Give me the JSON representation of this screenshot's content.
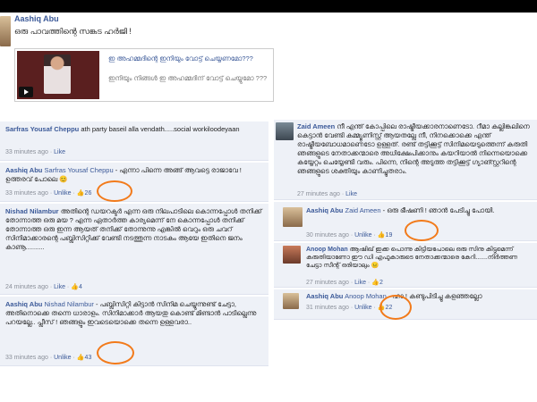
{
  "post": {
    "author": "Aashiq Abu",
    "text": "ഒരു പാവത്തിന്റെ സങ്കട ഹർജി !",
    "card_title": "ഇ അഹമ്മദിന്റെ ഇനിയും വോട്ട് ചെയ്യണമോ???",
    "card_desc": "ഇനിയും നിങ്ങൾ ഇ അഹമ്മദിന് വോട്ട് ചെയ്യുമോ ???"
  },
  "left_comments": [
    {
      "author": "Sarfras Yousaf Cheppu",
      "text": "ath party baseil alla vendath.....social workiloodeyaan",
      "time": "33 minutes ago",
      "sep": "·",
      "action": "Like",
      "likes": ""
    },
    {
      "author": "Aashiq Abu",
      "mention": "Sarfras Yousaf Cheppu",
      "text": "- എന്നാ പിന്നെ അങ്ങ് ആവട്ടെ രാജാവേ ! ഉത്തരവ് പോലെ 😊",
      "time": "33 minutes ago",
      "sep": "·",
      "action": "Unlike",
      "likes": "26"
    },
    {
      "author": "Nishad Nilambur",
      "text": "അതിന്റെ ഡയറക്ടർ എന്ന ഒരു നിലപാടിലെ കൊന്നപ്പോൾ തനിക്ക് തോന്നാത്ത ഒരു മയ ? എന്ന ഏതാർത്ത കാര്യമെന്ന് നേ കൊന്നപ്പോൾ തനിക്ക് തോന്നാത്ത ഒരു ഇന്ന ആയത് തനിക്ക് തോന്നുന്നു എങ്കിൽ വെറും ഒരു ചവറ് സിനിമാക്കാരന്റെ പബ്ലിസിറ്റിക്ക് വേണ്ടി നടത്തുന്ന നാടകം ആയേ ഇതിനെ ജനം കാണൂ..........",
      "time": "24 minutes ago",
      "sep": "·",
      "action": "Like",
      "likes": "4"
    },
    {
      "author": "Aashiq Abu",
      "mention": "Nishad Nilambur",
      "text": "- പബ്ലിസിറ്റി കിട്ടാൻ സിനിമ ചെയ്യുന്നുണ്ട് ചേട്ടാ, അതിനൊക്കെ തന്നെ ധാരാളം. സിനിമാക്കാർ ആയതു കൊണ്ട് മിണ്ടാൻ പാടില്ലെന്നു പറയല്ലേ.. പ്ലീസ് ! ഞങ്ങളും ഇവടെയൊക്കെ തന്നെ ഉള്ളവരാ..",
      "time": "33 minutes ago",
      "sep": "·",
      "action": "Unlike",
      "likes": "43"
    }
  ],
  "right_comments": [
    {
      "author": "Zaid Ameen",
      "text": "നീ എന്ത് കോപ്പിലെ രാഷ്ട്രീയക്കാരനാണെടോ. റീമാ കല്ലിങ്കലിനെ കെട്ടാൻ വേണ്ടി കമ്മ്യൂണിസ്റ്റ് ആയതല്ലേ നീ, നിനക്കൊക്കെ എന്ത് രാഷ്ട്രീയബോധമാണെടോ ഉള്ളത്. രണ്ട് തട്ടിക്കൂട്ട് സിനിമയെടുത്തെന്ന് കരുതി ഞങ്ങളുടെ നേതാക്കന്മാരെ അധിക്ഷേപിക്കാനും കയറിയാൽ നിന്നെയൊക്കെ കയ്യേറ്റം ചെയ്യേണ്ടി വരും. പിന്നെ, നിന്റെ അടുത്ത തട്ടിക്കൂട്ട് ഗ്യാങ്സ്റ്ററിന്റെ ഞങ്ങളുടെ ശക്തിയും കാണിച്ചുതരാം.",
      "time": "27 minutes ago",
      "sep": "·",
      "action": "Like",
      "likes": ""
    },
    {
      "author": "Aashiq Abu",
      "mention": "Zaid Ameen",
      "text": "- ഒരു ഭീഷണി ! ഞാൻ പേടിച്ചു പോയി.",
      "time": "30 minutes ago",
      "sep": "·",
      "action": "Unlike",
      "likes": "19"
    },
    {
      "author": "Anoop Mohan",
      "text": "ആഷിഖ് ഇക്ക പൊന്നു കിട്ടിയപോലെ ഒരു സിനു കിട്ടുമെന്ന് കരുതിയാണോ ഈ ഡി എഫുകാരുടെ നേതാക്കന്മാരെ കേറി.......നിർത്തണ ചേട്ടാ സീന്റ് ഒരിയാലും 😐",
      "time": "27 minutes ago",
      "sep": "·",
      "action": "Like",
      "likes": "2"
    },
    {
      "author": "Aashiq Abu",
      "mention": "Anoop Mohan",
      "text": "- ഹാ ! കണ്ടുപിടിച്ചു കളഞ്ഞല്ലോ",
      "time": "31 minutes ago",
      "sep": "·",
      "action": "Unlike",
      "likes": "22"
    }
  ],
  "colors": {
    "link": "#3b5998",
    "highlight_circle": "#f27a1a",
    "comment_bg": "#eef1f7"
  }
}
